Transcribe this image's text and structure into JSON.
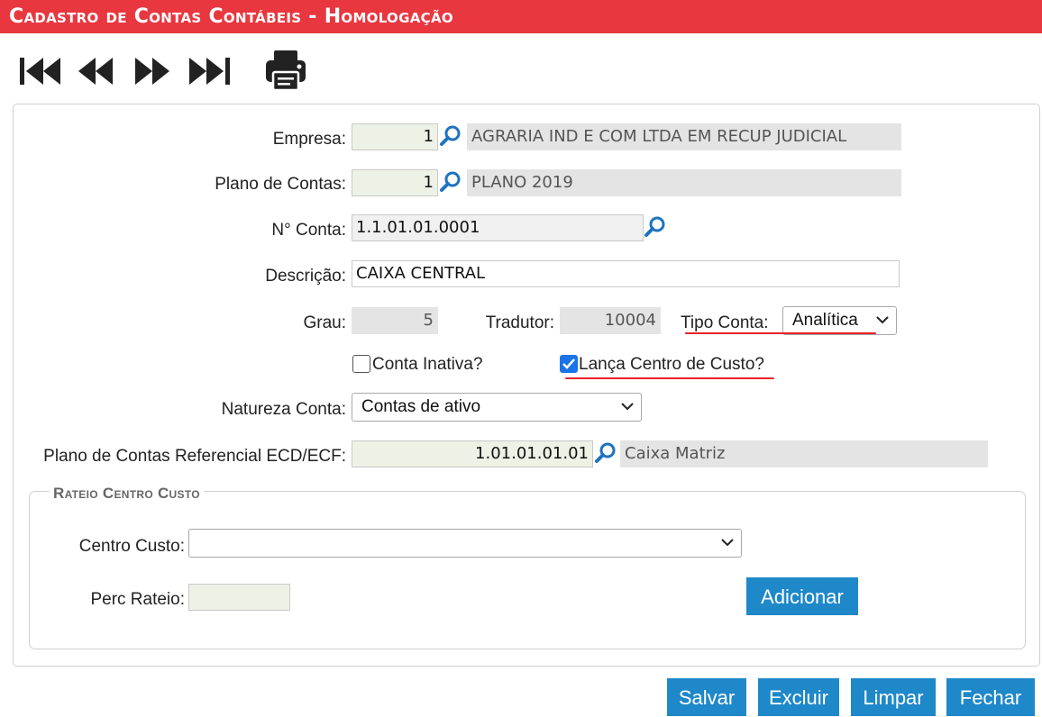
{
  "title": "Cadastro de Contas Contábeis  - Homologação",
  "nav": {
    "first": "first-icon",
    "previous": "previous-icon",
    "next": "next-icon",
    "last": "last-icon",
    "print": "print-icon"
  },
  "form": {
    "empresa": {
      "label": "Empresa:",
      "code": "1",
      "name": "AGRARIA IND E COM LTDA EM RECUP JUDICIAL"
    },
    "plano": {
      "label": "Plano de Contas:",
      "code": "1",
      "name": "PLANO 2019"
    },
    "conta": {
      "label": "N° Conta:",
      "value": "1.1.01.01.0001"
    },
    "descricao": {
      "label": "Descrição:",
      "value": "CAIXA CENTRAL"
    },
    "grau": {
      "label": "Grau:",
      "value": "5"
    },
    "tradutor": {
      "label": "Tradutor:",
      "value": "10004"
    },
    "tipo": {
      "label": "Tipo Conta:",
      "value": "Analítica"
    },
    "inativa": {
      "label": "Conta Inativa?",
      "checked": false
    },
    "centro": {
      "label": "Lança Centro de Custo?",
      "checked": true
    },
    "natureza": {
      "label": "Natureza Conta:",
      "value": "Contas de ativo"
    },
    "referencial": {
      "label": "Plano de Contas Referencial ECD/ECF:",
      "code": "1.01.01.01.01",
      "name": "Caixa Matriz"
    }
  },
  "rateio": {
    "legend": "Rateio Centro Custo",
    "centro_label": "Centro Custo:",
    "centro_value": "",
    "perc_label": "Perc Rateio:",
    "perc_value": "",
    "add_label": "Adicionar"
  },
  "actions": {
    "save": "Salvar",
    "delete": "Excluir",
    "clear": "Limpar",
    "close": "Fechar"
  },
  "colors": {
    "title_bar": "#e8373f",
    "button": "#1e88c9",
    "highlight": "#e8202a"
  }
}
